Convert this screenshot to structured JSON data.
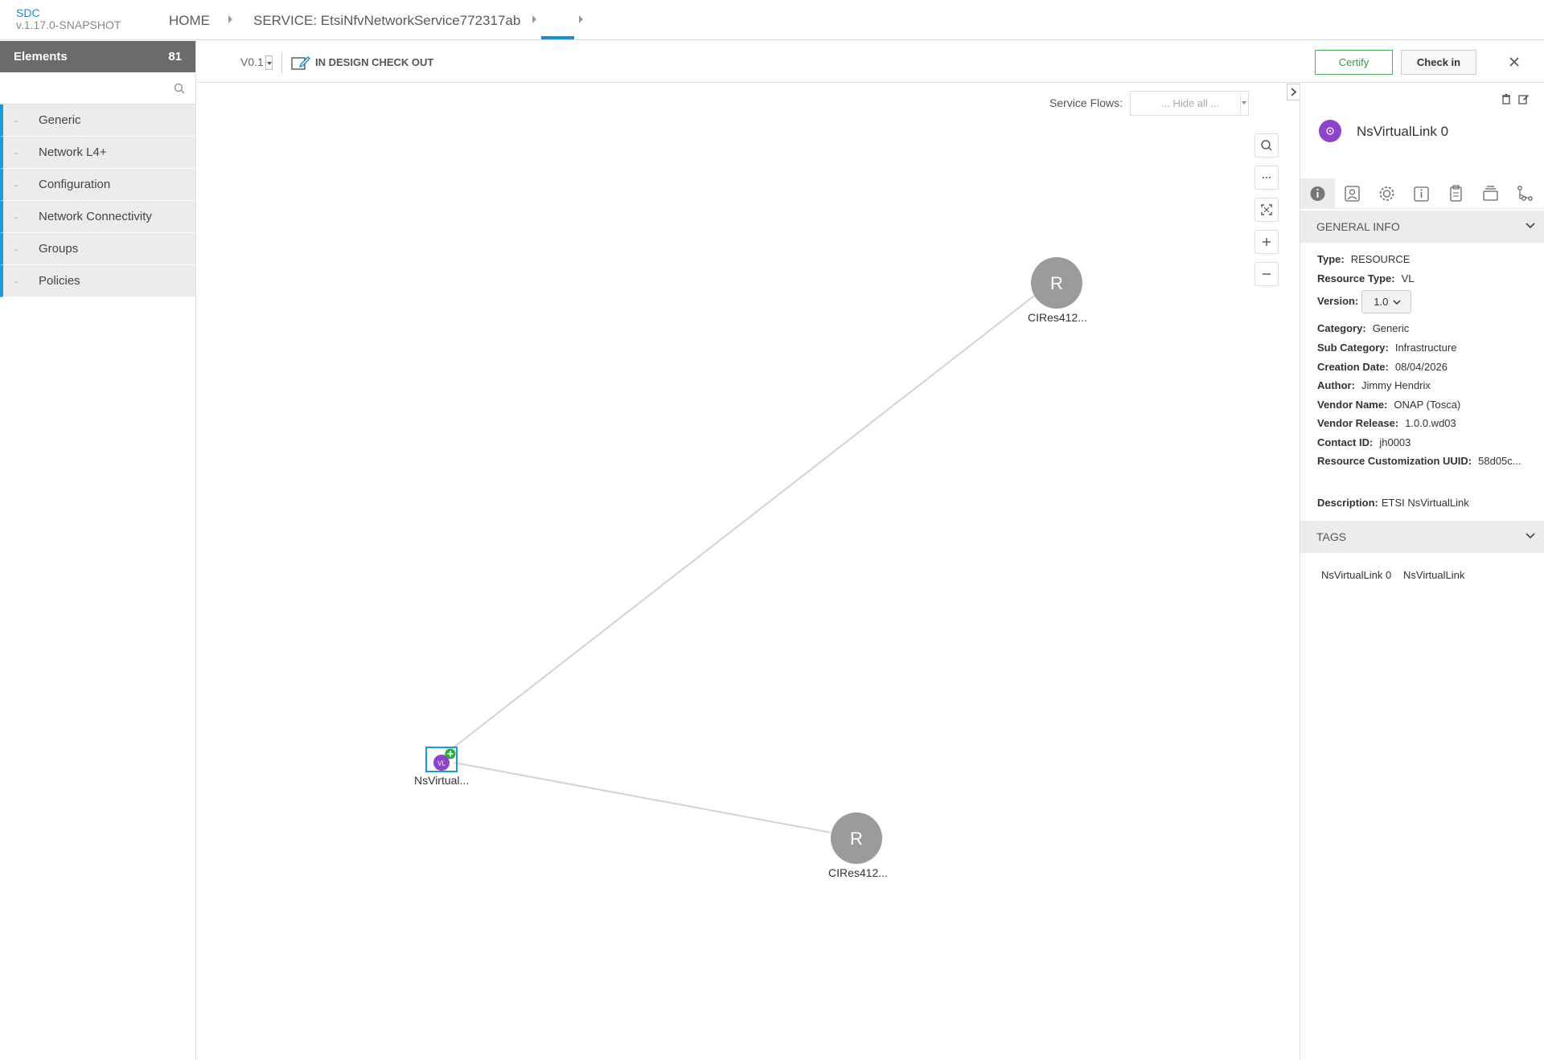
{
  "app": {
    "brand_name": "SDC",
    "brand_version": "v.1.17.0-SNAPSHOT"
  },
  "breadcrumb": {
    "home": "HOME",
    "service": "SERVICE: EtsiNfvNetworkService772317ab"
  },
  "palette": {
    "title": "Elements",
    "count": "81",
    "search_placeholder": "",
    "items": [
      {
        "label": "Generic"
      },
      {
        "label": "Network L4+"
      },
      {
        "label": "Configuration"
      },
      {
        "label": "Network Connectivity"
      },
      {
        "label": "Groups"
      },
      {
        "label": "Policies"
      }
    ]
  },
  "toolbar": {
    "version": "V0.1",
    "status": "IN DESIGN CHECK OUT",
    "certify_label": "Certify",
    "checkin_label": "Check in"
  },
  "canvas": {
    "service_flows_label": "Service Flows:",
    "service_flows_value": "... Hide all ...",
    "nodes": [
      {
        "label": "CIRes412...",
        "letter": "R"
      },
      {
        "label": "NsVirtual...",
        "letter": "VL"
      },
      {
        "label": "CIRes412...",
        "letter": "R"
      }
    ]
  },
  "panel": {
    "title": "NsVirtualLink 0",
    "general_info_title": "GENERAL INFO",
    "fields": {
      "type_label": "Type:",
      "type_value": "RESOURCE",
      "resource_type_label": "Resource Type:",
      "resource_type_value": "VL",
      "version_label": "Version:",
      "version_value": "1.0",
      "category_label": "Category:",
      "category_value": "Generic",
      "subcategory_label": "Sub Category:",
      "subcategory_value": "Infrastructure",
      "creation_date_label": "Creation Date:",
      "creation_date_value": "08/04/2026",
      "author_label": "Author:",
      "author_value": "Jimmy Hendrix",
      "vendor_name_label": "Vendor Name:",
      "vendor_name_value": "ONAP (Tosca)",
      "vendor_release_label": "Vendor Release:",
      "vendor_release_value": "1.0.0.wd03",
      "contact_id_label": "Contact ID:",
      "contact_id_value": "jh0003",
      "uuid_label": "Resource Customization UUID:",
      "uuid_value": "58d05c...",
      "description_label": "Description:",
      "description_value": "ETSI NsVirtualLink"
    },
    "tags_title": "TAGS",
    "tags": [
      "NsVirtualLink 0",
      "NsVirtualLink"
    ]
  },
  "colors": {
    "accent": "#1b8ccf",
    "certify_green": "#3a9c3a",
    "node_gray": "#9b9b9b",
    "vl_purple": "#8e44c9"
  }
}
